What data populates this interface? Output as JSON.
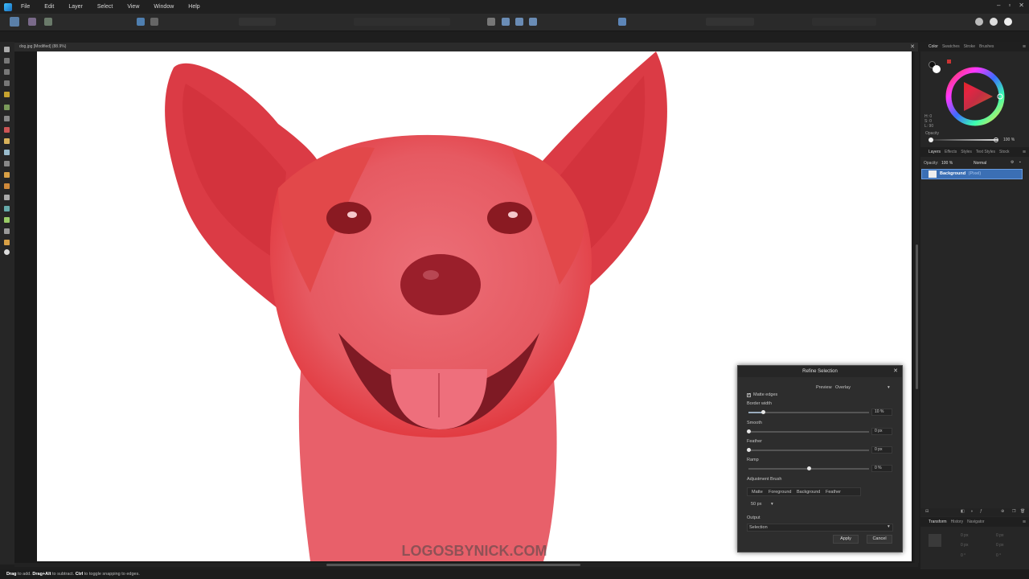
{
  "menubar": {
    "items": [
      "File",
      "Edit",
      "Layer",
      "Select",
      "View",
      "Window",
      "Help"
    ]
  },
  "document": {
    "tab_title": "dog.jpg [Modified] (88.9%)"
  },
  "watermark": "LOGOSBYNICK.COM",
  "statusbar": {
    "segments": [
      {
        "text": "Drag",
        "bold": true
      },
      {
        "text": " to add. ",
        "bold": false
      },
      {
        "text": "Drag+Alt",
        "bold": true
      },
      {
        "text": " to subtract. ",
        "bold": false
      },
      {
        "text": "Ctrl",
        "bold": true
      },
      {
        "text": " to toggle snapping to edges.",
        "bold": false
      }
    ]
  },
  "color_panel": {
    "tabs": [
      "Color",
      "Swatches",
      "Stroke",
      "Brushes"
    ],
    "hsl": {
      "h": "H: 0",
      "s": "S: 0",
      "l": "L: 90"
    },
    "opacity_label": "Opacity",
    "opacity_value": "100 %"
  },
  "layers_panel": {
    "tabs": [
      "Layers",
      "Effects",
      "Styles",
      "Text Styles",
      "Stock"
    ],
    "opacity_label": "Opacity:",
    "opacity_value": "100 %",
    "blend_mode": "Normal",
    "layer_name": "Background",
    "layer_type": "(Pixel)"
  },
  "transform_panel": {
    "tabs": [
      "Transform",
      "History",
      "Navigator"
    ],
    "fields": [
      "0 px",
      "0 px",
      "0 px",
      "0 px",
      "0 °",
      "0 °"
    ]
  },
  "dialog": {
    "title": "Refine Selection",
    "preview_label": "Preview",
    "preview_value": "Overlay",
    "matte_edges": "Matte edges",
    "border_width_label": "Border width",
    "border_width_value": "10 %",
    "border_width_frac": 0.12,
    "smooth_label": "Smooth",
    "smooth_value": "0 px",
    "feather_label": "Feather",
    "feather_value": "0 px",
    "ramp_label": "Ramp",
    "ramp_value": "0 %",
    "ramp_frac": 0.5,
    "adjustment_brush_label": "Adjustment Brush",
    "brush_modes": [
      "Matte",
      "Foreground",
      "Background",
      "Feather"
    ],
    "brush_size": "50 px",
    "output_label": "Output",
    "output_value": "Selection",
    "apply_label": "Apply",
    "cancel_label": "Cancel"
  },
  "colors": {
    "overlay": "#e0454f",
    "accent_blue": "#3b6fb4"
  }
}
